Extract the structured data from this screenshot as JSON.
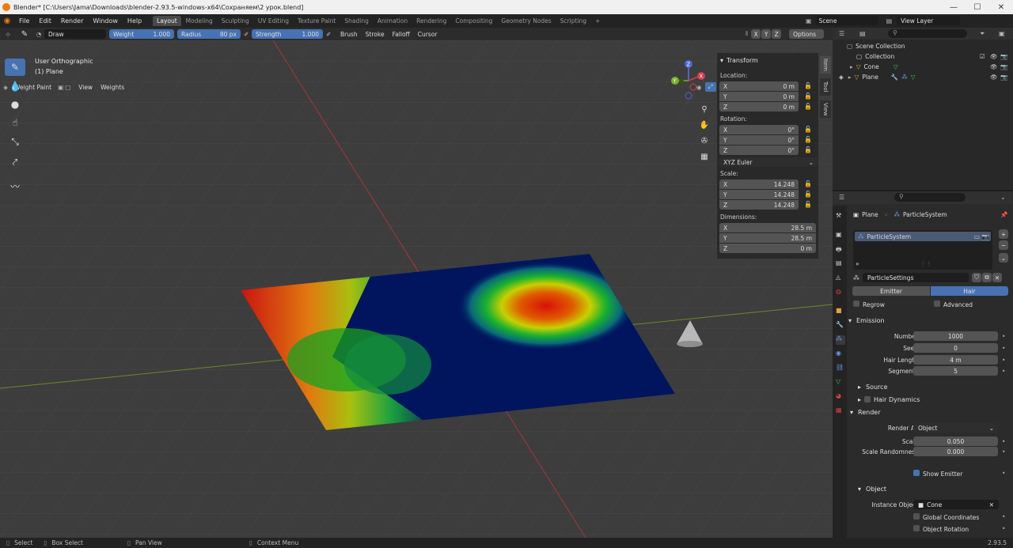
{
  "window": {
    "title": "Blender* [C:\\Users\\Jama\\Downloads\\blender-2.93.5-windows-x64\\Сохраняем\\2 урок.blend]",
    "minimize": "—",
    "maximize": "☐",
    "close": "✕"
  },
  "menu": [
    "File",
    "Edit",
    "Render",
    "Window",
    "Help"
  ],
  "workspaces": [
    "Layout",
    "Modeling",
    "Sculpting",
    "UV Editing",
    "Texture Paint",
    "Shading",
    "Animation",
    "Rendering",
    "Compositing",
    "Geometry Nodes",
    "Scripting"
  ],
  "scene": {
    "name": "Scene",
    "view_layer": "View Layer"
  },
  "tool_header": {
    "brush_name": "Draw",
    "weight_label": "Weight",
    "weight_value": "1.000",
    "radius_label": "Radius",
    "radius_value": "80 px",
    "strength_label": "Strength",
    "strength_value": "1.000",
    "brush_menu": "Brush",
    "stroke_menu": "Stroke",
    "falloff_menu": "Falloff",
    "cursor_menu": "Cursor",
    "options_menu": "Options",
    "axis_x": "X",
    "axis_y": "Y",
    "axis_z": "Z"
  },
  "viewport_header": {
    "mode": "Weight Paint",
    "view_menu": "View",
    "weights_menu": "Weights"
  },
  "viewport": {
    "view_name": "User Orthographic",
    "object_name": "(1) Plane"
  },
  "transform": {
    "title": "Transform",
    "location_label": "Location:",
    "location": [
      {
        "axis": "X",
        "value": "0 m"
      },
      {
        "axis": "Y",
        "value": "0 m"
      },
      {
        "axis": "Z",
        "value": "0 m"
      }
    ],
    "rotation_label": "Rotation:",
    "rotation": [
      {
        "axis": "X",
        "value": "0°"
      },
      {
        "axis": "Y",
        "value": "0°"
      },
      {
        "axis": "Z",
        "value": "0°"
      }
    ],
    "rotation_mode": "XYZ Euler",
    "scale_label": "Scale:",
    "scale": [
      {
        "axis": "X",
        "value": "14.248"
      },
      {
        "axis": "Y",
        "value": "14.248"
      },
      {
        "axis": "Z",
        "value": "14.248"
      }
    ],
    "dimensions_label": "Dimensions:",
    "dimensions": [
      {
        "axis": "X",
        "value": "28.5 m"
      },
      {
        "axis": "Y",
        "value": "28.5 m"
      },
      {
        "axis": "Z",
        "value": "0 m"
      }
    ]
  },
  "sidebar_tabs": [
    "Item",
    "Tool",
    "View"
  ],
  "outliner": {
    "root": "Scene Collection",
    "collection": "Collection",
    "objects": [
      "Cone",
      "Plane"
    ]
  },
  "properties": {
    "object": "Plane",
    "particle_system": "ParticleSystem",
    "list_item": "ParticleSystem",
    "settings_name": "ParticleSettings",
    "emitter_tab": "Emitter",
    "hair_tab": "Hair",
    "regrow_label": "Regrow",
    "advanced_label": "Advanced",
    "emission": {
      "title": "Emission",
      "number_label": "Number",
      "number": "1000",
      "seed_label": "Seed",
      "seed": "0",
      "hair_length_label": "Hair Length",
      "hair_length": "4 m",
      "segments_label": "Segments",
      "segments": "5"
    },
    "source_title": "Source",
    "hair_dynamics_title": "Hair Dynamics",
    "render": {
      "title": "Render",
      "render_as_label": "Render As",
      "render_as": "Object",
      "scale_label": "Scale",
      "scale": "0.050",
      "scale_randomness_label": "Scale Randomness",
      "scale_randomness": "0.000",
      "show_emitter_label": "Show Emitter"
    },
    "object_sub": {
      "title": "Object",
      "instance_label": "Instance Object",
      "instance_value": "Cone",
      "global_coords_label": "Global Coordinates",
      "object_rotation_label": "Object Rotation"
    }
  },
  "statusbar": {
    "select": "Select",
    "box_select": "Box Select",
    "pan_view": "Pan View",
    "context_menu": "Context Menu",
    "version": "2.93.5"
  },
  "colors": {
    "accent": "#4772b3",
    "background": "#1d1d1d",
    "viewport": "#3d3d3d"
  }
}
